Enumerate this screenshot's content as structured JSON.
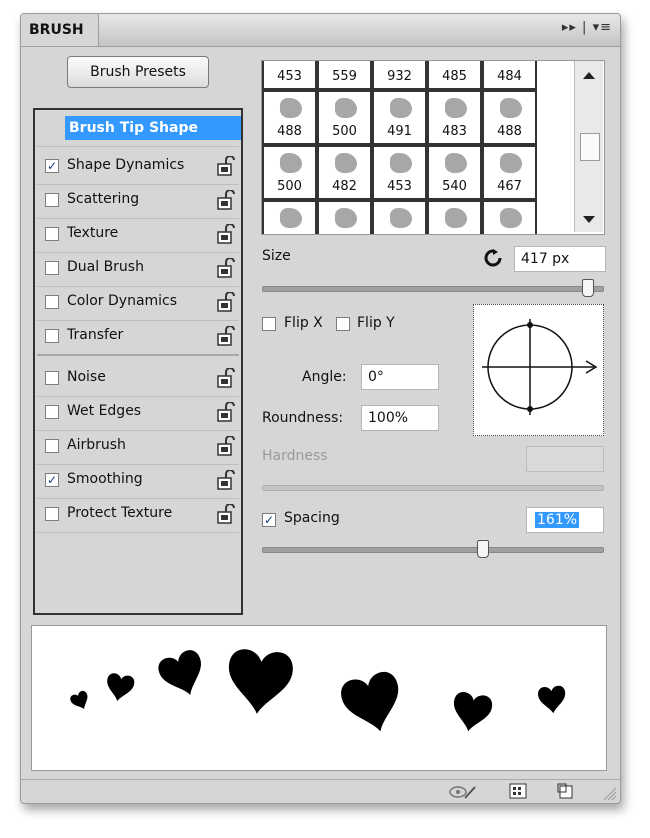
{
  "panel": {
    "tab_title": "BRUSH",
    "menu_glyphs": "▸▸ | ▾≡"
  },
  "preset_button": "Brush Presets",
  "options": [
    {
      "label": "Brush Tip Shape",
      "selected": true
    },
    {
      "label": "Shape Dynamics",
      "checked": true
    },
    {
      "label": "Scattering",
      "checked": false
    },
    {
      "label": "Texture",
      "checked": false
    },
    {
      "label": "Dual Brush",
      "checked": false
    },
    {
      "label": "Color Dynamics",
      "checked": false
    },
    {
      "label": "Transfer",
      "checked": false
    },
    {
      "label": "Noise",
      "checked": false
    },
    {
      "label": "Wet Edges",
      "checked": false
    },
    {
      "label": "Airbrush",
      "checked": false
    },
    {
      "label": "Smoothing",
      "checked": true
    },
    {
      "label": "Protect Texture",
      "checked": false
    }
  ],
  "brush_grid": {
    "rows": [
      [
        "453",
        "559",
        "932",
        "485",
        "484"
      ],
      [
        "488",
        "500",
        "491",
        "483",
        "488"
      ],
      [
        "500",
        "482",
        "453",
        "540",
        "467"
      ],
      [
        "",
        "",
        "",
        "",
        ""
      ]
    ]
  },
  "size": {
    "label": "Size",
    "value": "417 px",
    "fraction": 0.96
  },
  "flip_x": {
    "label": "Flip X",
    "checked": false
  },
  "flip_y": {
    "label": "Flip Y",
    "checked": false
  },
  "angle": {
    "label": "Angle:",
    "value": "0°"
  },
  "roundness": {
    "label": "Roundness:",
    "value": "100%"
  },
  "hardness": {
    "label": "Hardness",
    "value": ""
  },
  "spacing": {
    "label": "Spacing",
    "checked": true,
    "value": "161%",
    "fraction": 0.65
  },
  "colors": {
    "accent": "#3399ff",
    "panel": "#d6d6d6"
  },
  "bottom_icons": [
    "eye-brush-icon",
    "grid-icon",
    "new-icon"
  ]
}
